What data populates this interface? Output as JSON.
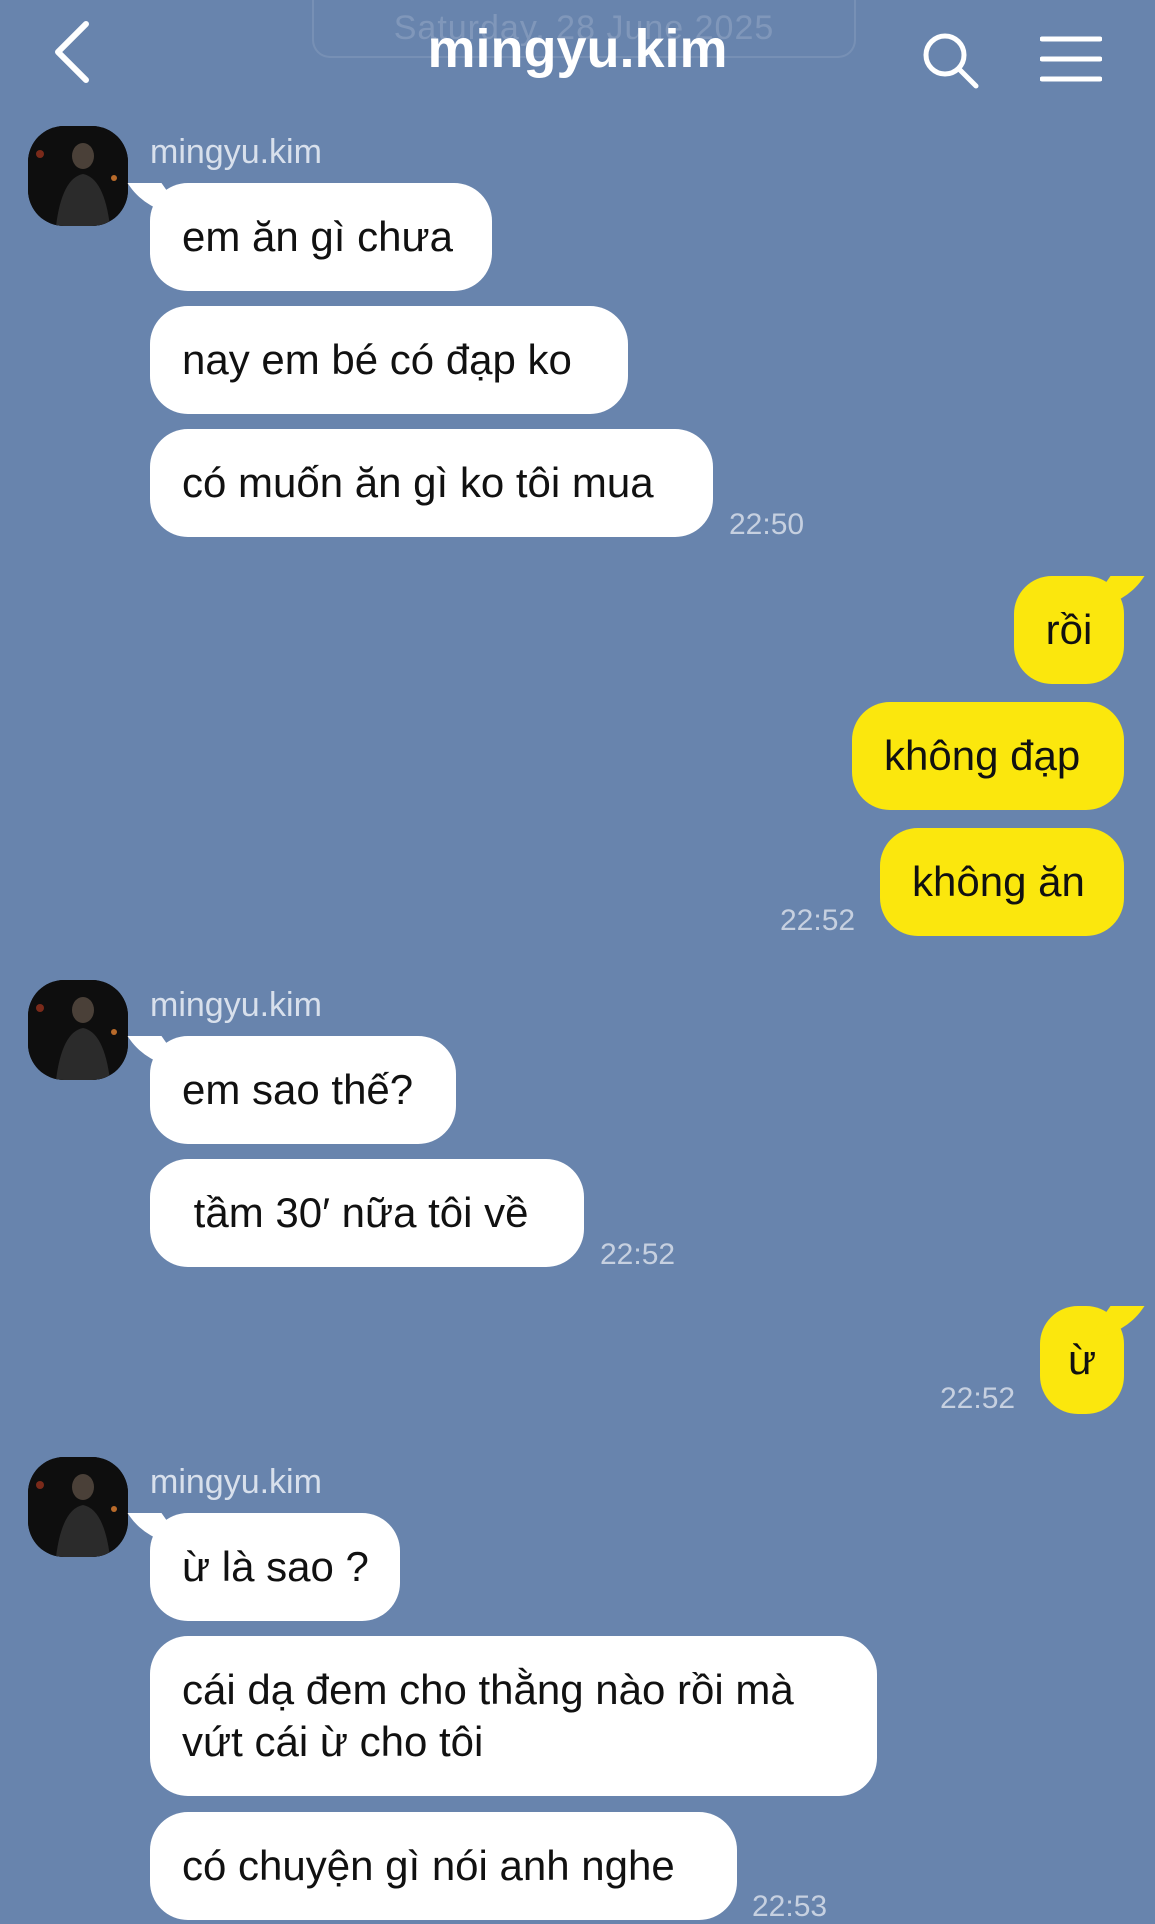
{
  "header": {
    "date": "Saturday, 28 June 2025",
    "title": "mingyu.kim",
    "back_icon": "chevron-left-icon",
    "search_icon": "search-icon",
    "menu_icon": "hamburger-menu-icon"
  },
  "colors": {
    "background": "#6884ad",
    "incoming_bubble": "#ffffff",
    "outgoing_bubble": "#fbe70d",
    "text": "#111111"
  },
  "messages": [
    {
      "sender": "mingyu.kim",
      "direction": "incoming",
      "bubbles": [
        "em ăn gì chưa",
        "nay em bé có đạp ko",
        "có muốn ăn gì ko tôi mua"
      ],
      "time": "22:50"
    },
    {
      "direction": "outgoing",
      "bubbles": [
        "rồi",
        "không đạp",
        "không ăn"
      ],
      "time": "22:52"
    },
    {
      "sender": "mingyu.kim",
      "direction": "incoming",
      "bubbles": [
        "em sao thế?",
        " tầm 30′ nữa tôi về"
      ],
      "time": "22:52"
    },
    {
      "direction": "outgoing",
      "bubbles": [
        "ừ"
      ],
      "time": "22:52"
    },
    {
      "sender": "mingyu.kim",
      "direction": "incoming",
      "bubbles": [
        "ừ là sao ?",
        "cái dạ đem cho thằng nào rồi mà vứt cái ừ cho tôi",
        "có chuyện gì nói anh nghe"
      ],
      "time": "22:53"
    }
  ]
}
